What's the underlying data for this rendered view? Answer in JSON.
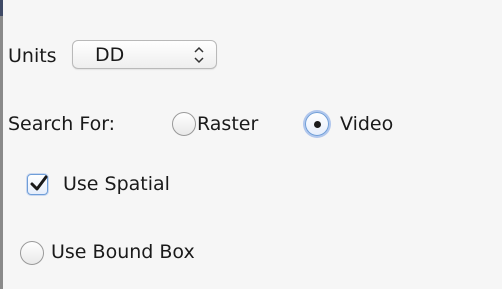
{
  "form": {
    "units": {
      "label": "Units",
      "selected": "DD",
      "arrows_glyph": "⌃⌄"
    },
    "search_for": {
      "label": "Search For:",
      "options": [
        {
          "label": "Raster",
          "selected": false
        },
        {
          "label": "Video",
          "selected": true
        }
      ]
    },
    "use_spatial": {
      "label": "Use Spatial",
      "checked": true
    },
    "use_bound_box": {
      "label": "Use Bound Box",
      "selected": false
    }
  },
  "icons": {
    "checkbox_check": "check-icon",
    "select_arrows": "up-down-chevron-icon"
  },
  "colors": {
    "background": "#f6f6f6",
    "focus_blue": "#6f9ed8"
  }
}
